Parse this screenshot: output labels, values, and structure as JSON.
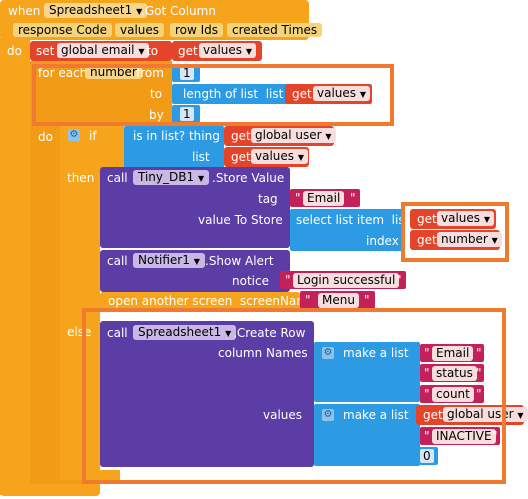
{
  "event": {
    "when": "when",
    "component": "Spreadsheet1",
    "event_name": ".Got Column",
    "params": [
      "response Code",
      "values",
      "row Ids",
      "created Times"
    ],
    "do": "do"
  },
  "set_block": {
    "set": "set",
    "var": "global email",
    "to": "to",
    "get": "get",
    "get_var": "values"
  },
  "for_each": {
    "for_each": "for each",
    "var": "number",
    "from": "from",
    "from_value": "1",
    "to": "to",
    "length_of_list": "length of list",
    "list": "list",
    "get": "get",
    "get_var": "values",
    "by": "by",
    "by_value": "1",
    "do": "do"
  },
  "if_block": {
    "if": "if",
    "is_in_list": "is in list? thing",
    "get1": "get",
    "var1": "global user",
    "list": "list",
    "get2": "get",
    "var2": "values",
    "then": "then",
    "else": "else"
  },
  "store": {
    "call": "call",
    "component": "Tiny_DB1",
    "method": ".Store Value",
    "tag": "tag",
    "tag_value": "Email",
    "value_to_store": "value To Store",
    "select_list_item": "select list item",
    "list": "list",
    "get1": "get",
    "var1": "values",
    "index": "index",
    "get2": "get",
    "var2": "number"
  },
  "alert": {
    "call": "call",
    "component": "Notifier1",
    "method": ".Show Alert",
    "notice": "notice",
    "notice_value": "Login successful"
  },
  "open_screen": {
    "label": "open another screen",
    "screen_name": "screenName",
    "value": "Menu"
  },
  "create_row": {
    "call": "call",
    "component": "Spreadsheet1",
    "method": ".Create Row",
    "column_names": "column Names",
    "make_a_list1": "make a list",
    "col1": "Email",
    "col2": "status",
    "col3": "count",
    "values": "values",
    "make_a_list2": "make a list",
    "get": "get",
    "var": "global user",
    "val2": "INACTIVE",
    "val3": "0"
  },
  "colors": {
    "event": "#f6a41c",
    "variable": "#e4442a",
    "list": "#2c9be3",
    "component": "#5c3da6",
    "text": "#c4205a",
    "highlight": "#f07a2f"
  }
}
